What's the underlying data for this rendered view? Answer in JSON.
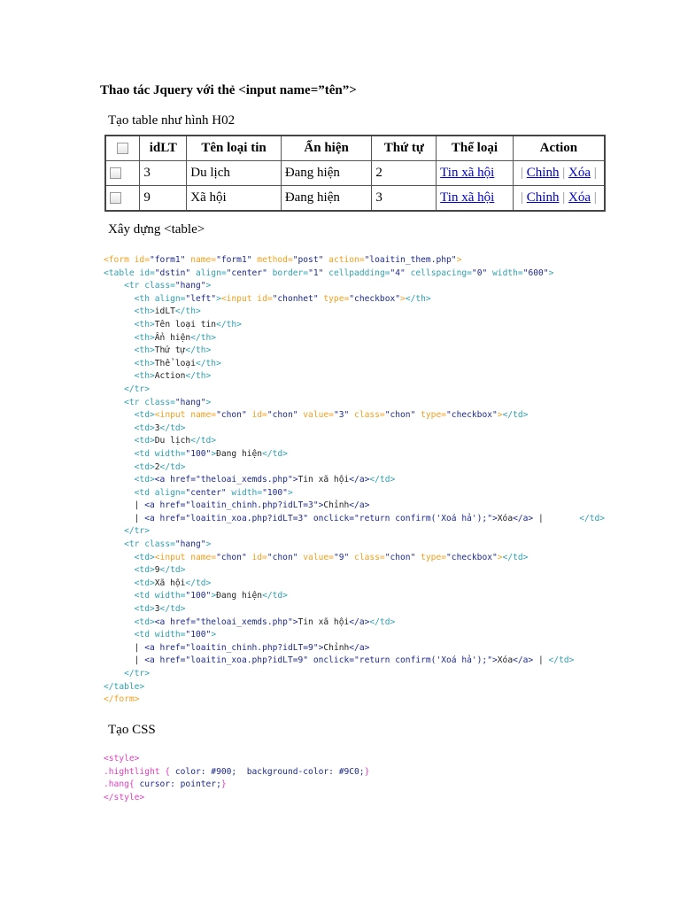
{
  "title": "Thao tác Jquery với thẻ <input name=”tên”>",
  "section1": "Tạo table như hình H02",
  "section2": "Xây dựng <table>",
  "section3": "Tạo CSS",
  "table": {
    "headers": [
      "idLT",
      "Tên loại tin",
      "Ẩn hiện",
      "Thứ tự",
      "Thể loại",
      "Action"
    ],
    "rows": [
      {
        "id": "3",
        "name": "Du lịch",
        "status": "Đang hiện",
        "order": "2",
        "category": "Tin xã hội",
        "edit": "Chỉnh",
        "delete": "Xóa",
        "sep": "|"
      },
      {
        "id": "9",
        "name": "Xã hội",
        "status": "Đang hiện",
        "order": "3",
        "category": "Tin xã hội",
        "edit": "Chỉnh",
        "delete": "Xóa",
        "sep": "|"
      }
    ]
  },
  "html_code": [
    [
      [
        "o",
        "<form id="
      ],
      [
        "v",
        "\"form1\""
      ],
      [
        "o",
        " name="
      ],
      [
        "v",
        "\"form1\""
      ],
      [
        "o",
        " method="
      ],
      [
        "v",
        "\"post\""
      ],
      [
        "o",
        " action="
      ],
      [
        "v",
        "\"loaitin_them.php\""
      ],
      [
        "o",
        ">"
      ]
    ],
    [
      [
        "t",
        "<table id="
      ],
      [
        "v",
        "\"dstin\""
      ],
      [
        "t",
        " align="
      ],
      [
        "v",
        "\"center\""
      ],
      [
        "t",
        " border="
      ],
      [
        "v",
        "\"1\""
      ],
      [
        "t",
        " cellpadding="
      ],
      [
        "v",
        "\"4\""
      ],
      [
        "t",
        " cellspacing="
      ],
      [
        "v",
        "\"0\""
      ],
      [
        "t",
        " width="
      ],
      [
        "v",
        "\"600\""
      ],
      [
        "t",
        ">"
      ]
    ],
    [
      [
        "k",
        "    "
      ],
      [
        "t",
        "<tr class="
      ],
      [
        "v",
        "\"hang\""
      ],
      [
        "t",
        ">"
      ]
    ],
    [
      [
        "k",
        "      "
      ],
      [
        "t",
        "<th align="
      ],
      [
        "v",
        "\"left\""
      ],
      [
        "t",
        ">"
      ],
      [
        "o",
        "<input id="
      ],
      [
        "v",
        "\"chonhet\""
      ],
      [
        "o",
        " type="
      ],
      [
        "v",
        "\"checkbox\""
      ],
      [
        "o",
        ">"
      ],
      [
        "t",
        "</th>"
      ]
    ],
    [
      [
        "k",
        "      "
      ],
      [
        "t",
        "<th>"
      ],
      [
        "k",
        "idLT"
      ],
      [
        "t",
        "</th>"
      ]
    ],
    [
      [
        "k",
        "      "
      ],
      [
        "t",
        "<th>"
      ],
      [
        "k",
        "Tên loại tin"
      ],
      [
        "t",
        "</th>"
      ]
    ],
    [
      [
        "k",
        "      "
      ],
      [
        "t",
        "<th>"
      ],
      [
        "k",
        "Ẩn hiện"
      ],
      [
        "t",
        "</th>"
      ]
    ],
    [
      [
        "k",
        "      "
      ],
      [
        "t",
        "<th>"
      ],
      [
        "k",
        "Thứ tự"
      ],
      [
        "t",
        "</th>"
      ]
    ],
    [
      [
        "k",
        "      "
      ],
      [
        "t",
        "<th>"
      ],
      [
        "k",
        "Thể loại"
      ],
      [
        "t",
        "</th>"
      ]
    ],
    [
      [
        "k",
        "      "
      ],
      [
        "t",
        "<th>"
      ],
      [
        "k",
        "Action"
      ],
      [
        "t",
        "</th>"
      ]
    ],
    [
      [
        "k",
        "    "
      ],
      [
        "t",
        "</tr>"
      ]
    ],
    [
      [
        "k",
        "    "
      ],
      [
        "t",
        "<tr class="
      ],
      [
        "v",
        "\"hang\""
      ],
      [
        "t",
        ">"
      ]
    ],
    [
      [
        "k",
        "      "
      ],
      [
        "t",
        "<td>"
      ],
      [
        "o",
        "<input name="
      ],
      [
        "v",
        "\"chon\""
      ],
      [
        "o",
        " id="
      ],
      [
        "v",
        "\"chon\""
      ],
      [
        "o",
        " value="
      ],
      [
        "v",
        "\"3\""
      ],
      [
        "o",
        " class="
      ],
      [
        "v",
        "\"chon\""
      ],
      [
        "o",
        " type="
      ],
      [
        "v",
        "\"checkbox\""
      ],
      [
        "o",
        ">"
      ],
      [
        "t",
        "</td>"
      ]
    ],
    [
      [
        "k",
        "      "
      ],
      [
        "t",
        "<td>"
      ],
      [
        "k",
        "3"
      ],
      [
        "t",
        "</td>"
      ]
    ],
    [
      [
        "k",
        "      "
      ],
      [
        "t",
        "<td>"
      ],
      [
        "k",
        "Du lịch"
      ],
      [
        "t",
        "</td>"
      ]
    ],
    [
      [
        "k",
        "      "
      ],
      [
        "t",
        "<td width="
      ],
      [
        "v",
        "\"100\""
      ],
      [
        "t",
        ">"
      ],
      [
        "k",
        "Đang hiện"
      ],
      [
        "t",
        "</td>"
      ]
    ],
    [
      [
        "k",
        "      "
      ],
      [
        "t",
        "<td>"
      ],
      [
        "k",
        "2"
      ],
      [
        "t",
        "</td>"
      ]
    ],
    [
      [
        "k",
        "      "
      ],
      [
        "t",
        "<td>"
      ],
      [
        "v",
        "<a href=\"theloai_xemds.php\">"
      ],
      [
        "k",
        "Tin xã hội"
      ],
      [
        "v",
        "</a>"
      ],
      [
        "t",
        "</td>"
      ]
    ],
    [
      [
        "k",
        "      "
      ],
      [
        "t",
        "<td align="
      ],
      [
        "v",
        "\"center\""
      ],
      [
        "t",
        " width="
      ],
      [
        "v",
        "\"100\""
      ],
      [
        "t",
        ">"
      ]
    ],
    [
      [
        "k",
        "      | "
      ],
      [
        "v",
        "<a href=\"loaitin_chinh.php?idLT=3\">"
      ],
      [
        "k",
        "Chỉnh"
      ],
      [
        "v",
        "</a>"
      ]
    ],
    [
      [
        "k",
        "      | "
      ],
      [
        "v",
        "<a href=\"loaitin_xoa.php?idLT=3\" onclick=\"return confirm('Xoá hả');\">"
      ],
      [
        "k",
        "Xóa"
      ],
      [
        "v",
        "</a>"
      ],
      [
        "k",
        " |       "
      ],
      [
        "t",
        "</td>"
      ]
    ],
    [
      [
        "k",
        "    "
      ],
      [
        "t",
        "</tr>"
      ]
    ],
    [
      [
        "k",
        "    "
      ],
      [
        "t",
        "<tr class="
      ],
      [
        "v",
        "\"hang\""
      ],
      [
        "t",
        ">"
      ]
    ],
    [
      [
        "k",
        "      "
      ],
      [
        "t",
        "<td>"
      ],
      [
        "o",
        "<input name="
      ],
      [
        "v",
        "\"chon\""
      ],
      [
        "o",
        " id="
      ],
      [
        "v",
        "\"chon\""
      ],
      [
        "o",
        " value="
      ],
      [
        "v",
        "\"9\""
      ],
      [
        "o",
        " class="
      ],
      [
        "v",
        "\"chon\""
      ],
      [
        "o",
        " type="
      ],
      [
        "v",
        "\"checkbox\""
      ],
      [
        "o",
        ">"
      ],
      [
        "t",
        "</td>"
      ]
    ],
    [
      [
        "k",
        "      "
      ],
      [
        "t",
        "<td>"
      ],
      [
        "k",
        "9"
      ],
      [
        "t",
        "</td>"
      ]
    ],
    [
      [
        "k",
        "      "
      ],
      [
        "t",
        "<td>"
      ],
      [
        "k",
        "Xã hội"
      ],
      [
        "t",
        "</td>"
      ]
    ],
    [
      [
        "k",
        "      "
      ],
      [
        "t",
        "<td width="
      ],
      [
        "v",
        "\"100\""
      ],
      [
        "t",
        ">"
      ],
      [
        "k",
        "Đang hiện"
      ],
      [
        "t",
        "</td>"
      ]
    ],
    [
      [
        "k",
        "      "
      ],
      [
        "t",
        "<td>"
      ],
      [
        "k",
        "3"
      ],
      [
        "t",
        "</td>"
      ]
    ],
    [
      [
        "k",
        "      "
      ],
      [
        "t",
        "<td>"
      ],
      [
        "v",
        "<a href=\"theloai_xemds.php\">"
      ],
      [
        "k",
        "Tin xã hội"
      ],
      [
        "v",
        "</a>"
      ],
      [
        "t",
        "</td>"
      ]
    ],
    [
      [
        "k",
        "      "
      ],
      [
        "t",
        "<td width="
      ],
      [
        "v",
        "\"100\""
      ],
      [
        "t",
        ">"
      ]
    ],
    [
      [
        "k",
        "      | "
      ],
      [
        "v",
        "<a href=\"loaitin_chinh.php?idLT=9\">"
      ],
      [
        "k",
        "Chỉnh"
      ],
      [
        "v",
        "</a>"
      ]
    ],
    [
      [
        "k",
        "      | "
      ],
      [
        "v",
        "<a href=\"loaitin_xoa.php?idLT=9\" onclick=\"return confirm('Xoá hả');\">"
      ],
      [
        "k",
        "Xóa"
      ],
      [
        "v",
        "</a>"
      ],
      [
        "k",
        " | "
      ],
      [
        "t",
        "</td>"
      ]
    ],
    [
      [
        "k",
        "    "
      ],
      [
        "t",
        "</tr>"
      ]
    ],
    [
      [
        "t",
        "</table>"
      ]
    ],
    [
      [
        "o",
        "</form>"
      ]
    ]
  ],
  "css_code": [
    [
      [
        "p",
        "<style>"
      ]
    ],
    [
      [
        "p",
        ".hightlight { "
      ],
      [
        "b",
        "color: #900;  background-color: #9C0;"
      ],
      [
        "p",
        "}"
      ]
    ],
    [
      [
        "p",
        ".hang{ "
      ],
      [
        "b",
        "cursor: pointer;"
      ],
      [
        "p",
        "}"
      ]
    ],
    [
      [
        "p",
        "</style>"
      ]
    ]
  ]
}
